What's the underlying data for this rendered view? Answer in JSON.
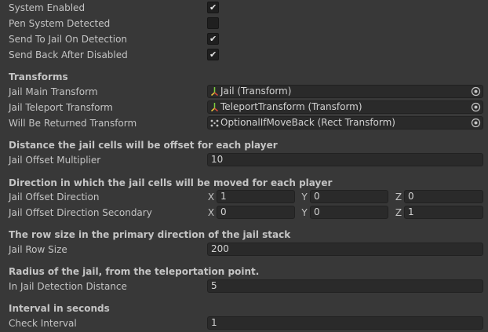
{
  "toggles": [
    {
      "label": "System Enabled",
      "checked": true
    },
    {
      "label": "Pen System Detected",
      "checked": false
    },
    {
      "label": "Send To Jail On Detection",
      "checked": true
    },
    {
      "label": "Send Back After Disabled",
      "checked": true
    }
  ],
  "check_mark": "✔",
  "transforms": {
    "header": "Transforms",
    "fields": [
      {
        "label": "Jail Main Transform",
        "value": "Jail (Transform)",
        "icon": "transform-icon"
      },
      {
        "label": "Jail Teleport Transform",
        "value": "TeleportTransform (Transform)",
        "icon": "transform-icon"
      },
      {
        "label": "Will Be Returned Transform",
        "value": "OptionalIfMoveBack (Rect Transform)",
        "icon": "rect-transform-icon"
      }
    ]
  },
  "offset": {
    "header": "Distance the jail cells will be offset for each player",
    "label": "Jail Offset Multiplier",
    "value": "10"
  },
  "direction": {
    "header": "Direction in which the jail cells will be moved for each player",
    "axes": [
      "X",
      "Y",
      "Z"
    ],
    "rows": [
      {
        "label": "Jail Offset Direction",
        "x": "1",
        "y": "0",
        "z": "0"
      },
      {
        "label": "Jail Offset Direction Secondary",
        "x": "0",
        "y": "0",
        "z": "1"
      }
    ]
  },
  "row_size": {
    "header": "The row size in the primary direction of the jail stack",
    "label": "Jail Row Size",
    "value": "200"
  },
  "radius": {
    "header": "Radius of the jail, from the teleportation point.",
    "label": "In Jail Detection Distance",
    "value": "5"
  },
  "interval": {
    "header": "Interval in seconds",
    "label": "Check Interval",
    "value": "1"
  }
}
